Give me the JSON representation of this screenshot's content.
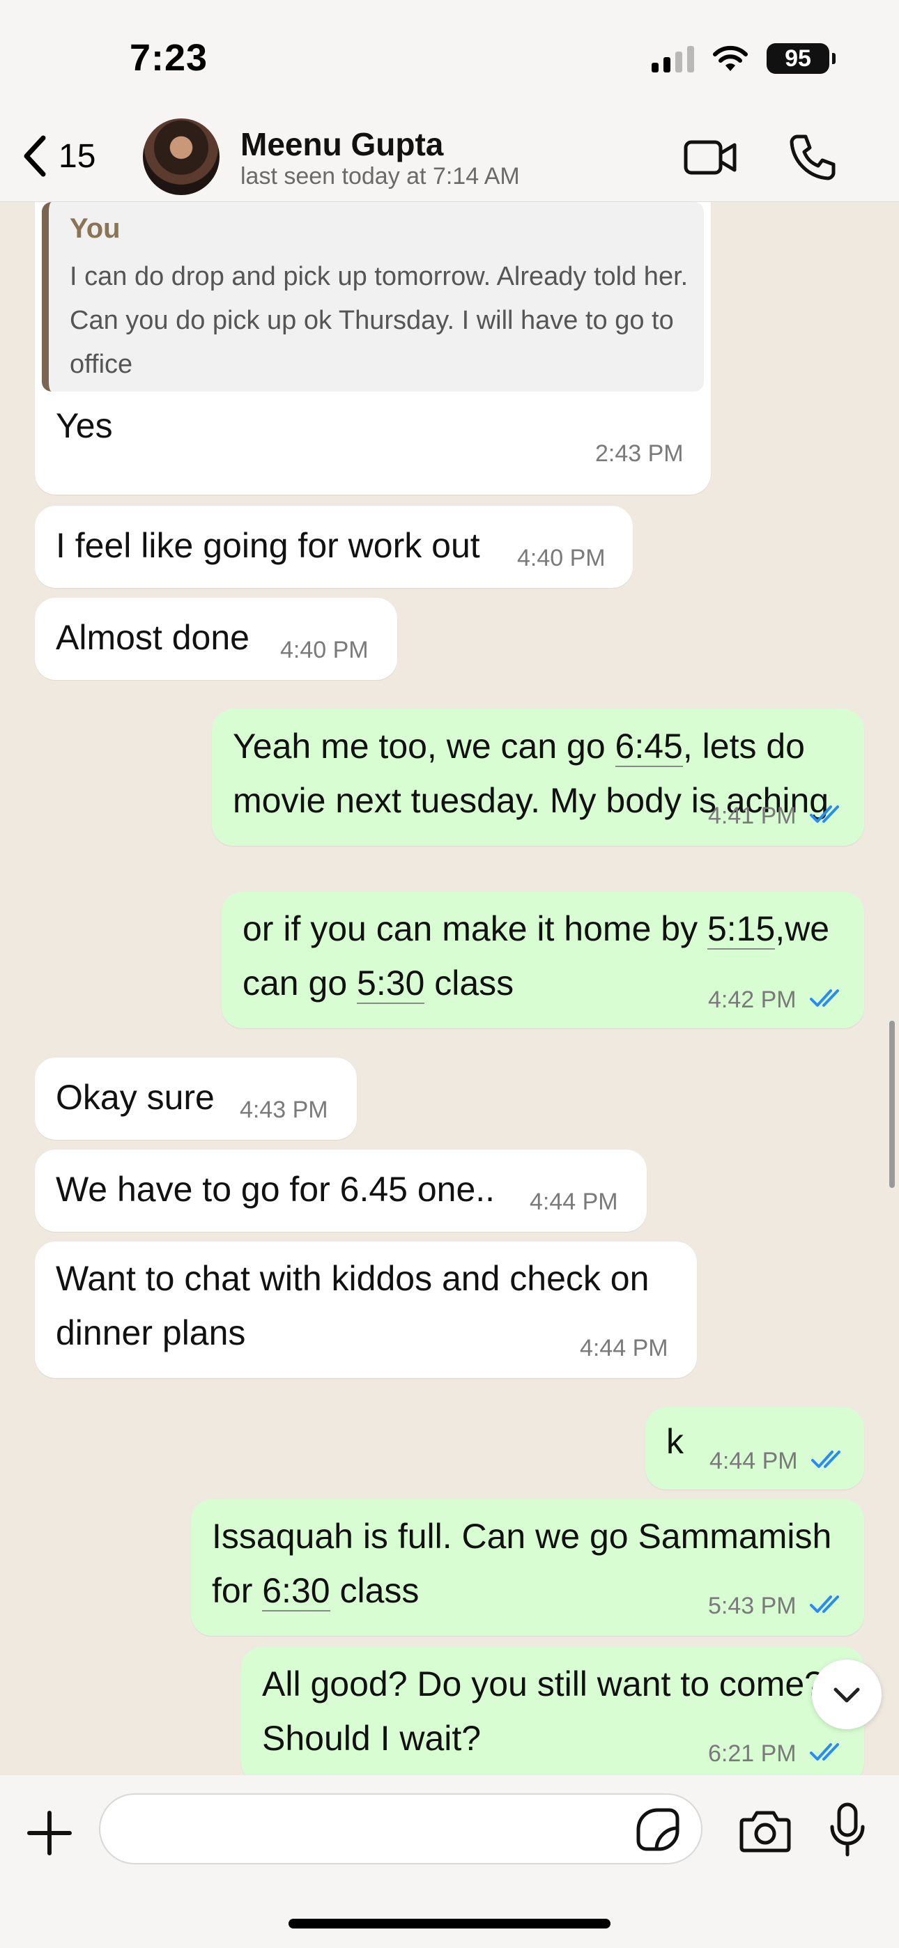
{
  "status_bar": {
    "time": "7:23",
    "battery": "95"
  },
  "header": {
    "back_count": "15",
    "contact_name": "Meenu Gupta",
    "last_seen": "last seen today at 7:14 AM"
  },
  "messages": [
    {
      "id": "m1",
      "direction": "incoming",
      "quote_author": "You",
      "quote_text": "I can do drop and pick up tomorrow. Already told her. Can you do pick up ok Thursday. I will have to go to office",
      "text": "Yes",
      "time": "2:43 PM"
    },
    {
      "id": "m2",
      "direction": "incoming",
      "text": "I feel like going for work out",
      "time": "4:40 PM"
    },
    {
      "id": "m3",
      "direction": "incoming",
      "text": "Almost done",
      "time": "4:40 PM"
    },
    {
      "id": "m4",
      "direction": "outgoing",
      "line1_a": "Yeah me too, we can go ",
      "line1_link": "6:45",
      "line1_b": ", lets do",
      "line2": "movie next tuesday. My body is aching",
      "time": "4:41 PM",
      "status": "read"
    },
    {
      "id": "m5",
      "direction": "outgoing",
      "line1_a": "or if you can make it home by ",
      "line1_link": "5:15",
      "line1_b": ",we",
      "line2_a": "can go ",
      "line2_link": "5:30",
      "line2_b": " class",
      "time": "4:42 PM",
      "status": "read"
    },
    {
      "id": "m6",
      "direction": "incoming",
      "text": "Okay sure",
      "time": "4:43 PM"
    },
    {
      "id": "m7",
      "direction": "incoming",
      "text": "We have to go for 6.45 one..",
      "time": "4:44 PM"
    },
    {
      "id": "m8",
      "direction": "incoming",
      "line1": "Want to chat with kiddos and check on",
      "line2": "dinner plans",
      "time": "4:44 PM"
    },
    {
      "id": "m9",
      "direction": "outgoing",
      "text": "k",
      "time": "4:44 PM",
      "status": "read"
    },
    {
      "id": "m10",
      "direction": "outgoing",
      "line1": "Issaquah is full. Can we go Sammamish",
      "line2_a": "for ",
      "line2_link": "6:30",
      "line2_b": " class",
      "time": "5:43 PM",
      "status": "read"
    },
    {
      "id": "m11",
      "direction": "outgoing",
      "line1": "All good? Do you still want to come?",
      "line2": "Should I wait?",
      "time": "6:21 PM",
      "status": "read"
    }
  ],
  "composer": {
    "placeholder": ""
  },
  "colors": {
    "incoming_bubble": "#ffffff",
    "outgoing_bubble": "#d9fdd3",
    "read_ticks": "#2a8cf0",
    "wallpaper": "#efe9e0"
  },
  "icons": [
    "back-chevron-icon",
    "video-call-icon",
    "phone-call-icon",
    "plus-icon",
    "sticker-icon",
    "camera-icon",
    "microphone-icon",
    "chevron-down-icon",
    "double-check-icon"
  ]
}
